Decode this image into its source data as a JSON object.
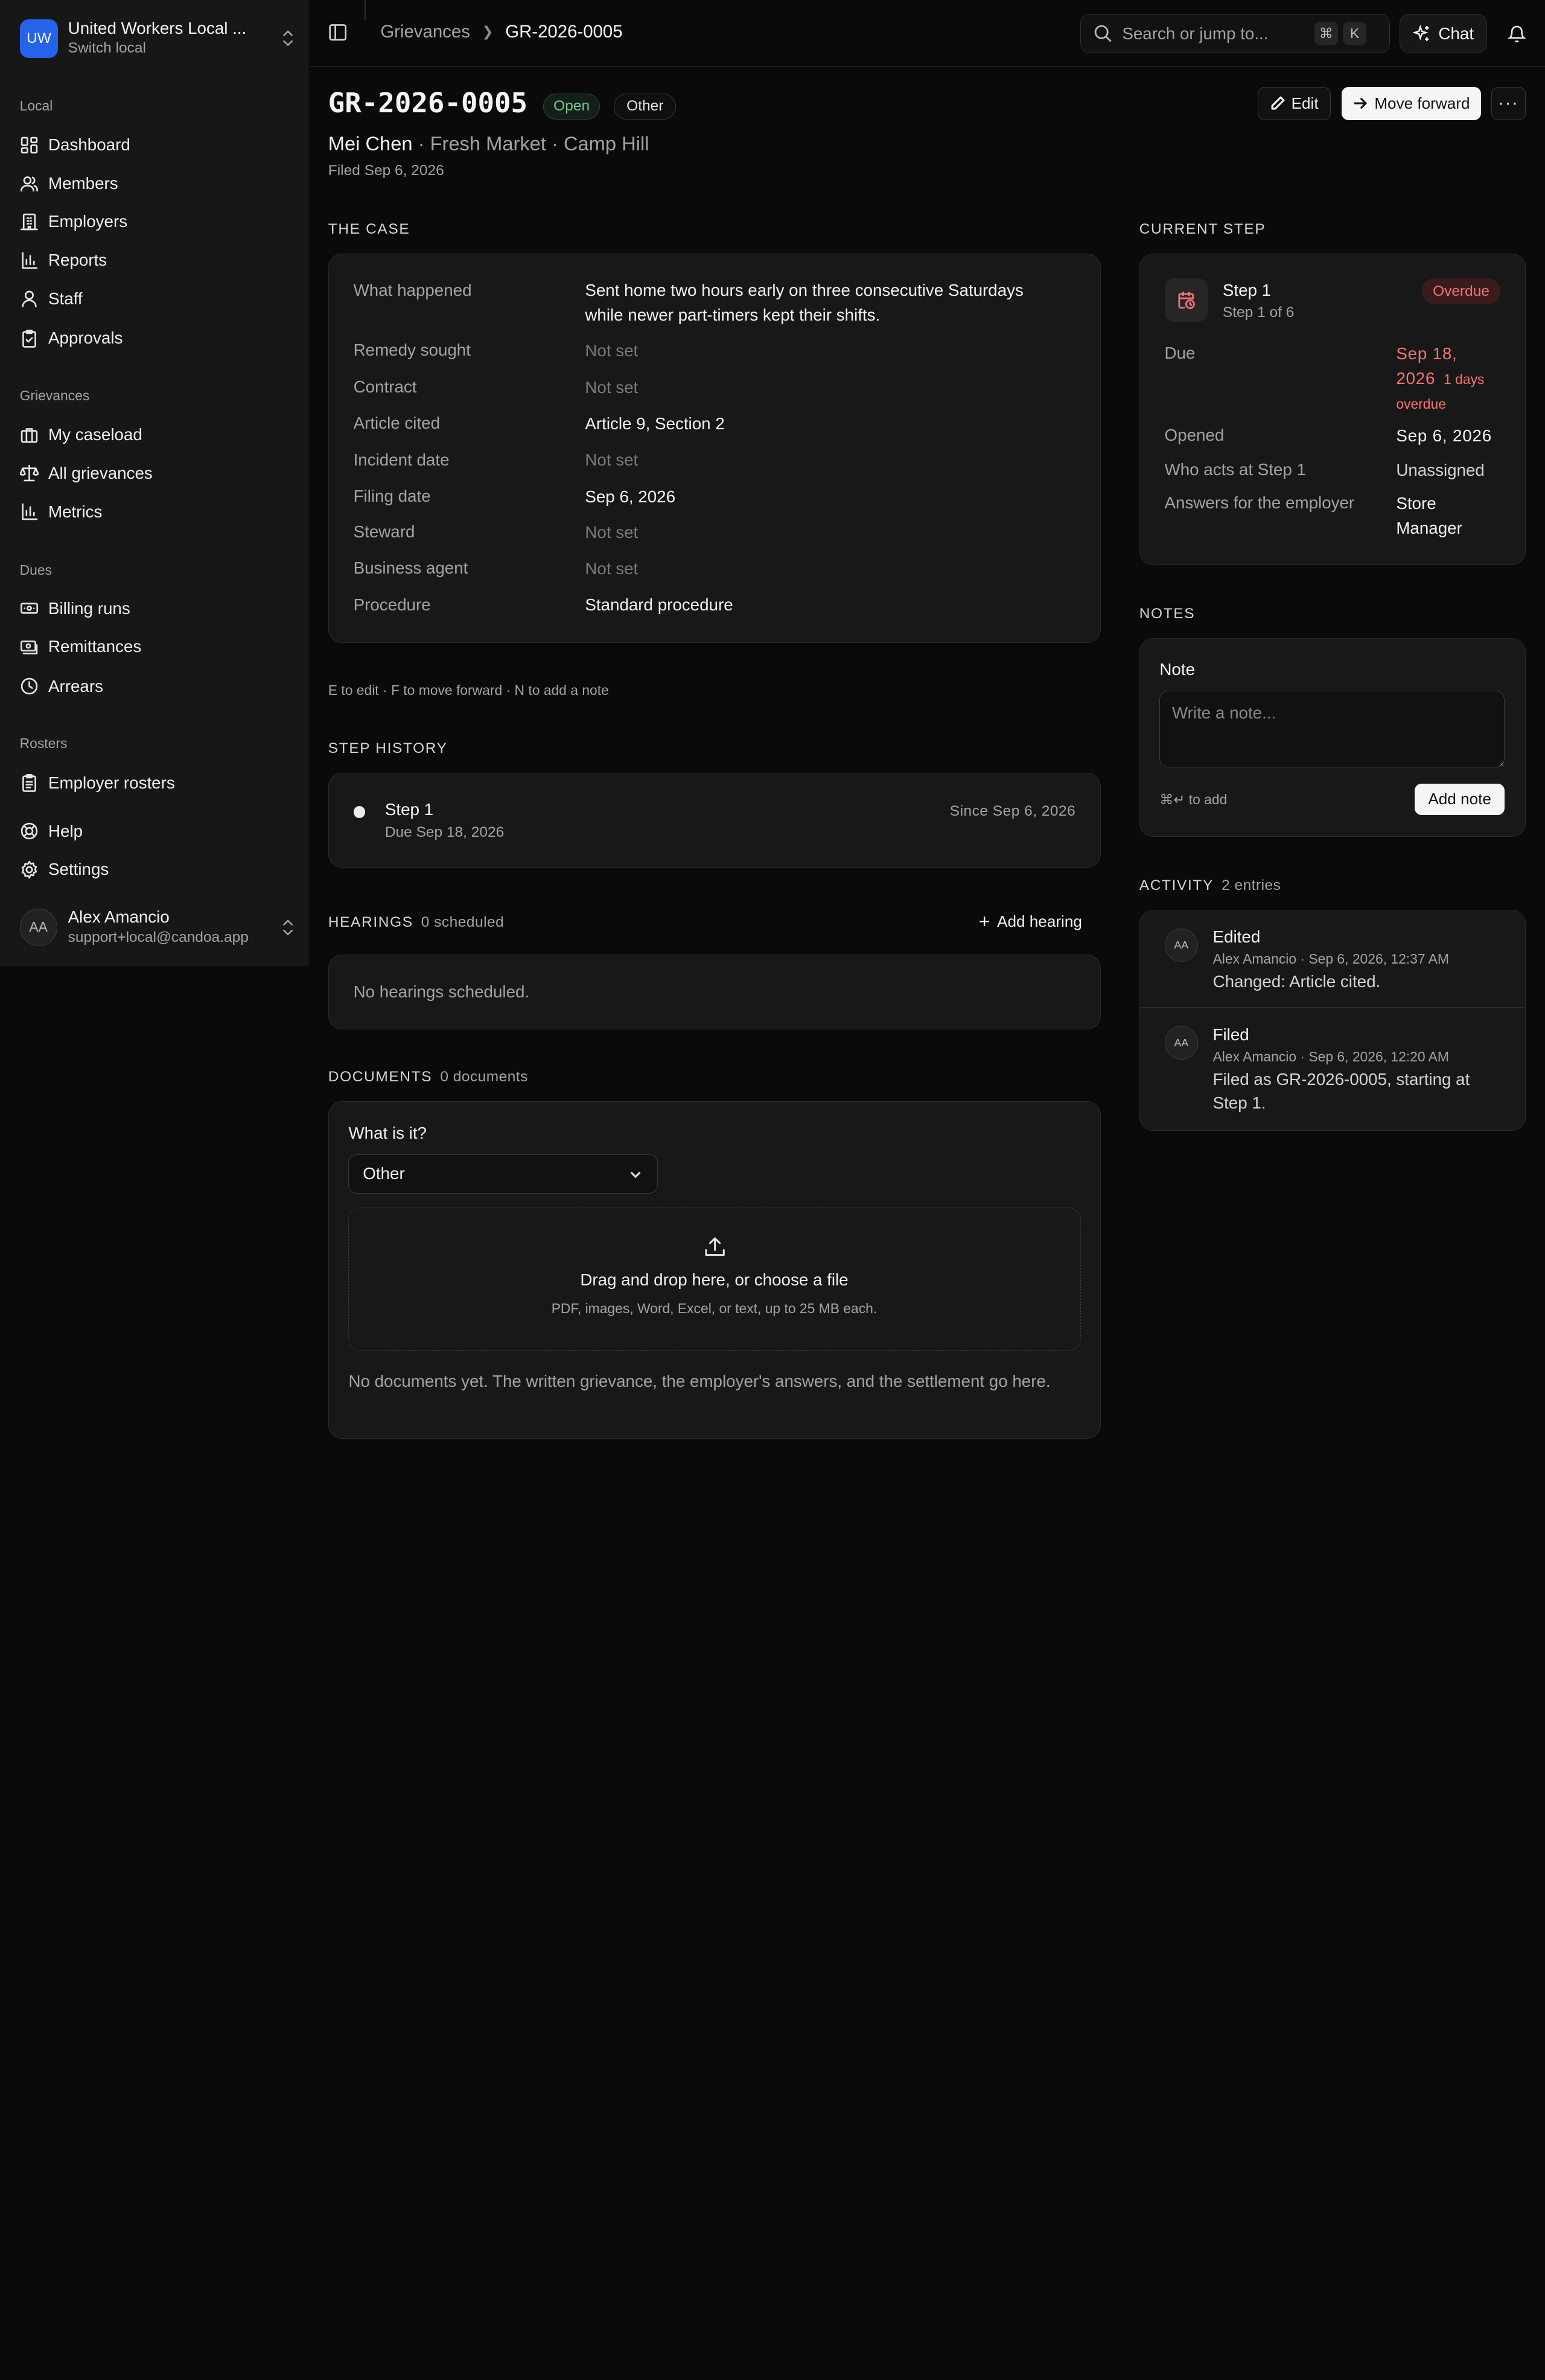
{
  "org": {
    "initials": "UW",
    "name": "United Workers Local ...",
    "sub": "Switch local"
  },
  "nav": {
    "local_label": "Local",
    "local": [
      {
        "label": "Dashboard",
        "icon": "dashboard-icon"
      },
      {
        "label": "Members",
        "icon": "members-icon"
      },
      {
        "label": "Employers",
        "icon": "building-icon"
      },
      {
        "label": "Reports",
        "icon": "bar-chart-icon"
      },
      {
        "label": "Staff",
        "icon": "user-icon"
      },
      {
        "label": "Approvals",
        "icon": "clipboard-check-icon"
      }
    ],
    "grievances_label": "Grievances",
    "grievances": [
      {
        "label": "My caseload",
        "icon": "briefcase-icon"
      },
      {
        "label": "All grievances",
        "icon": "scale-icon"
      },
      {
        "label": "Metrics",
        "icon": "bar-chart-icon"
      }
    ],
    "dues_label": "Dues",
    "dues": [
      {
        "label": "Billing runs",
        "icon": "banknote-icon"
      },
      {
        "label": "Remittances",
        "icon": "receipt-icon"
      },
      {
        "label": "Arrears",
        "icon": "clock-icon"
      }
    ],
    "rosters_label": "Rosters",
    "rosters": [
      {
        "label": "Employer rosters",
        "icon": "clipboard-list-icon"
      }
    ],
    "help": "Help",
    "settings": "Settings"
  },
  "user": {
    "initials": "AA",
    "name": "Alex Amancio",
    "email": "support+local@candoa.app"
  },
  "topbar": {
    "breadcrumb_parent": "Grievances",
    "breadcrumb_current": "GR-2026-0005",
    "search_placeholder": "Search or jump to...",
    "kbd_cmd": "⌘",
    "kbd_k": "K",
    "chat_label": "Chat"
  },
  "header": {
    "case_id": "GR-2026-0005",
    "status": "Open",
    "category": "Other",
    "member": "Mei Chen",
    "employer": " · Fresh Market · Camp Hill",
    "filed": "Filed Sep 6, 2026",
    "edit_label": "Edit",
    "move_label": "Move forward",
    "more_label": "···"
  },
  "case": {
    "heading": "THE CASE",
    "rows": [
      {
        "key": "What happened",
        "value": "Sent home two hours early on three consecutive Saturdays while newer part-timers kept their shifts.",
        "unset": false
      },
      {
        "key": "Remedy sought",
        "value": "Not set",
        "unset": true
      },
      {
        "key": "Contract",
        "value": "Not set",
        "unset": true
      },
      {
        "key": "Article cited",
        "value": "Article 9, Section 2",
        "unset": false
      },
      {
        "key": "Incident date",
        "value": "Not set",
        "unset": true
      },
      {
        "key": "Filing date",
        "value": "Sep 6, 2026",
        "unset": false
      },
      {
        "key": "Steward",
        "value": "Not set",
        "unset": true
      },
      {
        "key": "Business agent",
        "value": "Not set",
        "unset": true
      },
      {
        "key": "Procedure",
        "value": "Standard procedure",
        "unset": false
      }
    ],
    "hint": "E to edit · F to move forward · N to add a note"
  },
  "step_history": {
    "heading": "STEP HISTORY",
    "step": "Step 1",
    "due": "Due Sep 18, 2026",
    "since": "Since Sep 6, 2026"
  },
  "hearings": {
    "heading": "HEARINGS",
    "count": "0 scheduled",
    "add_label": "Add hearing",
    "empty": "No hearings scheduled."
  },
  "documents": {
    "heading": "DOCUMENTS",
    "count": "0 documents",
    "type_label": "What is it?",
    "type_value": "Other",
    "drop_title": "Drag and drop here, or choose a file",
    "drop_sub": "PDF, images, Word, Excel, or text, up to 25 MB each.",
    "empty": "No documents yet. The written grievance, the employer's answers, and the settlement go here."
  },
  "current_step": {
    "heading": "CURRENT STEP",
    "step": "Step 1",
    "step_of": "Step 1 of 6",
    "badge": "Overdue",
    "due_label": "Due",
    "due_date_1": "Sep 18,",
    "due_date_2": "2026",
    "due_overdue_1": "1 days",
    "due_overdue_2": "overdue",
    "opened_label": "Opened",
    "opened_value": "Sep 6, 2026",
    "who_label": "Who acts at Step 1",
    "who_value": "Unassigned",
    "answers_label": "Answers for the employer",
    "answers_value_1": "Store",
    "answers_value_2": "Manager"
  },
  "notes": {
    "heading": "NOTES",
    "label": "Note",
    "placeholder": "Write a note...",
    "shortcut": "⌘↵ to add",
    "add_label": "Add note"
  },
  "activity": {
    "heading": "ACTIVITY",
    "count": "2 entries",
    "entries": [
      {
        "initials": "AA",
        "title": "Edited",
        "meta": "Alex Amancio · Sep 6, 2026, 12:37 AM",
        "body": "Changed: Article cited."
      },
      {
        "initials": "AA",
        "title": "Filed",
        "meta": "Alex Amancio · Sep 6, 2026, 12:20 AM",
        "body": "Filed as GR-2026-0005, starting at Step 1."
      }
    ]
  },
  "colors": {
    "accent": "#2563eb",
    "danger": "#f87171",
    "success": "#7cc490"
  }
}
